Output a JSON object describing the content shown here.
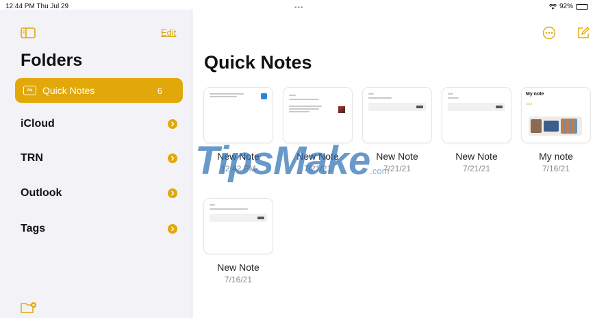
{
  "status_bar": {
    "time": "12:44 PM  Thu Jul 29",
    "battery": "92%",
    "battery_level": 0.92
  },
  "sidebar": {
    "edit_label": "Edit",
    "title": "Folders",
    "folders": [
      {
        "label": "Quick Notes",
        "count": "6",
        "selected": true,
        "icon": "quick-note-icon"
      },
      {
        "label": "iCloud",
        "icon": "chevron-right-icon"
      },
      {
        "label": "TRN",
        "icon": "chevron-right-icon"
      },
      {
        "label": "Outlook",
        "icon": "chevron-right-icon"
      },
      {
        "label": "Tags",
        "icon": "chevron-right-icon"
      }
    ]
  },
  "main": {
    "title": "Quick Notes",
    "notes": [
      {
        "name": "New Note",
        "date": "12:42 PM"
      },
      {
        "name": "New Note",
        "date": "7/21/21"
      },
      {
        "name": "New Note",
        "date": "7/21/21"
      },
      {
        "name": "New Note",
        "date": "7/21/21"
      },
      {
        "name": "My note",
        "date": "7/16/21",
        "thumb_title": "My note",
        "thumb_sub": "Shelf"
      },
      {
        "name": "New Note",
        "date": "7/16/21"
      }
    ]
  },
  "watermark": {
    "text": "TipsMake",
    "suffix": ".com"
  },
  "colors": {
    "accent": "#e2a80a",
    "sidebar_bg": "#f2f2f7"
  }
}
